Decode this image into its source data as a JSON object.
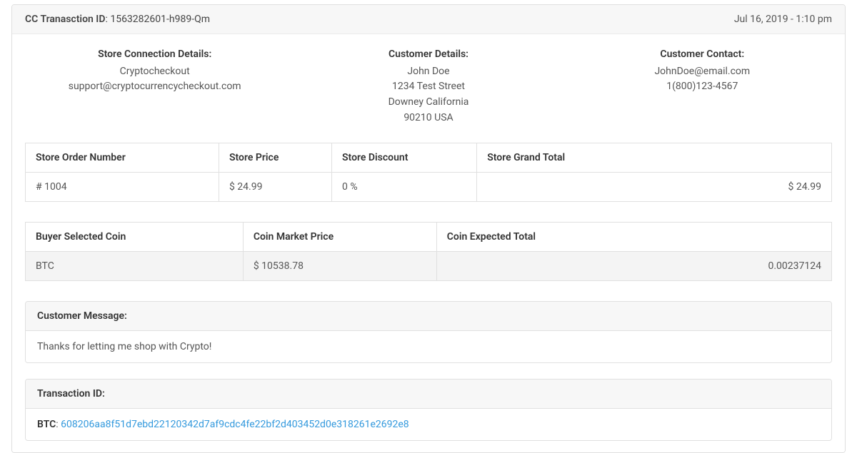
{
  "header": {
    "label": "CC Tranasction ID",
    "value": "1563282601-h989-Qm",
    "timestamp": "Jul 16, 2019 - 1:10 pm"
  },
  "store_connection": {
    "title": "Store Connection Details:",
    "name": "Cryptocheckout",
    "email": "support@cryptocurrencycheckout.com"
  },
  "customer_details": {
    "title": "Customer Details:",
    "name": "John Doe",
    "street": "1234 Test Street",
    "city": "Downey California",
    "postal": "90210 USA"
  },
  "customer_contact": {
    "title": "Customer Contact:",
    "email": "JohnDoe@email.com",
    "phone": "1(800)123-4567"
  },
  "order_table": {
    "headers": {
      "order_number": "Store Order Number",
      "price": "Store Price",
      "discount": "Store Discount",
      "grand_total": "Store Grand Total"
    },
    "row": {
      "order_number": "# 1004",
      "price": "$ 24.99",
      "discount": "0 %",
      "grand_total": "$ 24.99"
    }
  },
  "coin_table": {
    "headers": {
      "selected_coin": "Buyer Selected Coin",
      "market_price": "Coin Market Price",
      "expected_total": "Coin Expected Total"
    },
    "row": {
      "selected_coin": "BTC",
      "market_price": "$ 10538.78",
      "expected_total": "0.00237124"
    }
  },
  "customer_message": {
    "title": "Customer Message:",
    "body": "Thanks for letting me shop with Crypto!"
  },
  "transaction": {
    "title": "Transaction ID:",
    "coin_label": "BTC",
    "txid": "608206aa8f51d7ebd22120342d7af9cdc4fe22bf2d403452d0e318261e2692e8"
  }
}
